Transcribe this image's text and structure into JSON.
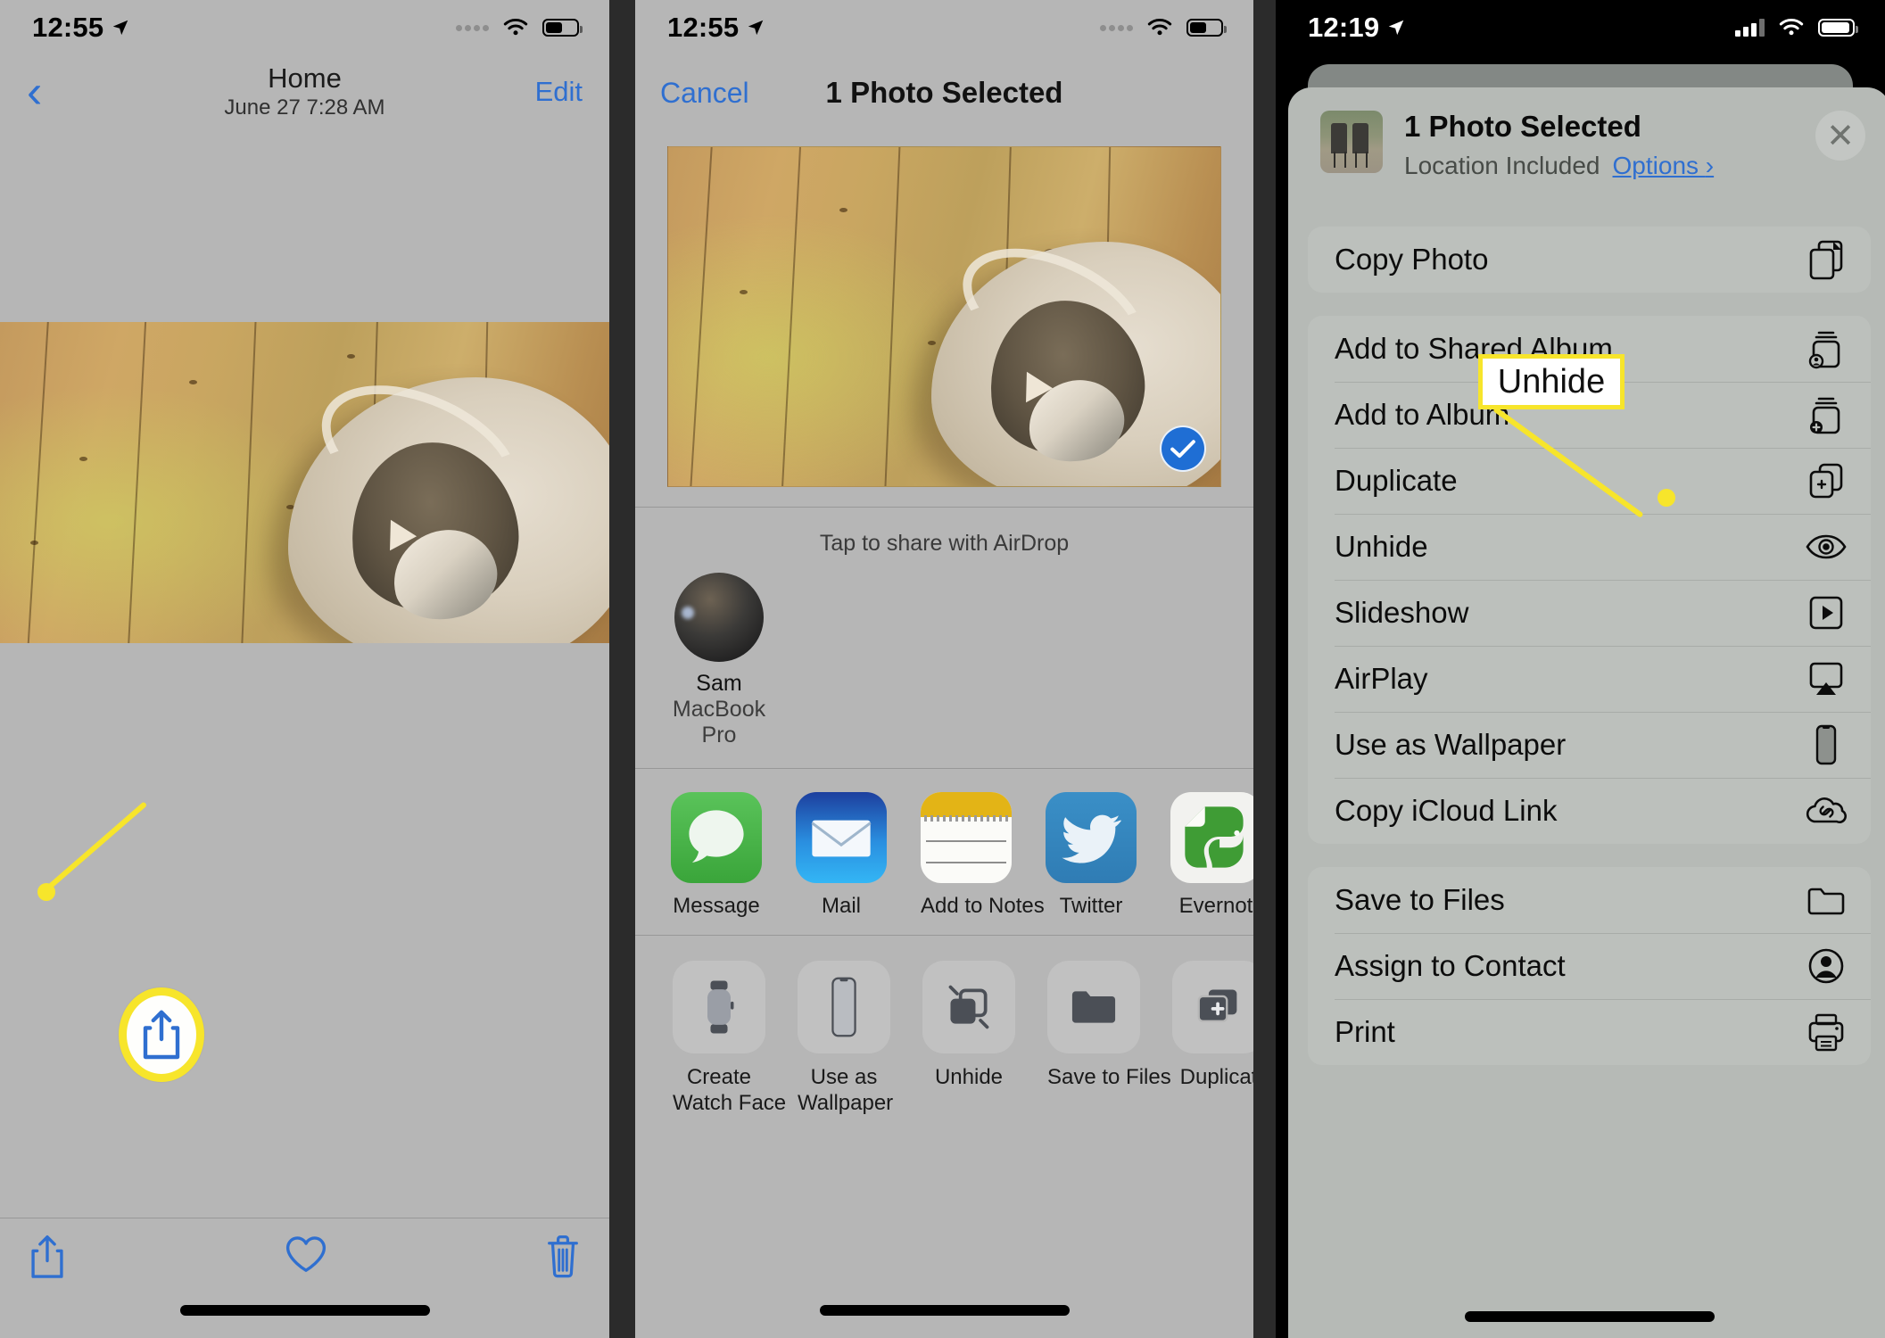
{
  "panels": {
    "left": {
      "status": {
        "time": "12:55",
        "location_icon": "location-arrow-icon",
        "signal": "dots",
        "wifi": "wifi-icon",
        "battery": "battery-icon"
      },
      "navbar": {
        "back_icon": "chevron-left-icon",
        "title": "Home",
        "subtitle": "June 27  7:28 AM",
        "edit_label": "Edit"
      },
      "photo_alt": "cat sleeping in a felt pet cave on a wooden floor",
      "toolbar": {
        "share_icon": "share-icon",
        "favorite_icon": "heart-icon",
        "delete_icon": "trash-icon"
      },
      "callout": {
        "icon": "share-icon",
        "shape": "circle-highlight"
      }
    },
    "middle": {
      "status": {
        "time": "12:55",
        "location_icon": "location-arrow-icon"
      },
      "navbar": {
        "cancel_label": "Cancel",
        "title": "1 Photo Selected"
      },
      "photo_alt": "cat sleeping in a felt pet cave on a wooden floor",
      "selected_badge": "checkmark-icon",
      "airdrop_hint": "Tap to share with AirDrop",
      "airdrop_contact": {
        "name": "Sam",
        "device": "MacBook Pro"
      },
      "apps": [
        {
          "label": "Message",
          "icon": "messages-app-icon"
        },
        {
          "label": "Mail",
          "icon": "mail-app-icon"
        },
        {
          "label": "Add to Notes",
          "icon": "notes-app-icon"
        },
        {
          "label": "Twitter",
          "icon": "twitter-app-icon"
        },
        {
          "label": "Evernot",
          "icon": "evernote-app-icon"
        }
      ],
      "actions": [
        {
          "label": "Create\nWatch Face",
          "icon": "apple-watch-icon"
        },
        {
          "label": "Use as\nWallpaper",
          "icon": "iphone-icon"
        },
        {
          "label": "Unhide",
          "icon": "unhide-icon"
        },
        {
          "label": "Save to Files",
          "icon": "folder-icon"
        },
        {
          "label": "Duplicat",
          "icon": "duplicate-icon"
        }
      ]
    },
    "right": {
      "status": {
        "time": "12:19",
        "location_icon": "location-arrow-icon",
        "signal": "bars",
        "wifi": "wifi-icon",
        "battery": "battery-icon"
      },
      "sheet_header": {
        "title": "1 Photo Selected",
        "subtitle": "Location Included",
        "options_label": "Options",
        "options_chevron": "chevron-right-icon",
        "close_icon": "close-icon",
        "thumbnail_alt": "two folding chairs outdoors"
      },
      "groups": [
        {
          "rows": [
            {
              "label": "Copy Photo",
              "icon": "copy-icon"
            }
          ]
        },
        {
          "rows": [
            {
              "label": "Add to Shared Album",
              "icon": "shared-album-icon"
            },
            {
              "label": "Add to Album",
              "icon": "add-album-icon"
            },
            {
              "label": "Duplicate",
              "icon": "duplicate-icon"
            },
            {
              "label": "Unhide",
              "icon": "eye-icon"
            },
            {
              "label": "Slideshow",
              "icon": "play-icon"
            },
            {
              "label": "AirPlay",
              "icon": "airplay-icon"
            },
            {
              "label": "Use as Wallpaper",
              "icon": "iphone-icon"
            },
            {
              "label": "Copy iCloud Link",
              "icon": "icloud-link-icon"
            }
          ]
        },
        {
          "rows": [
            {
              "label": "Save to Files",
              "icon": "folder-icon"
            },
            {
              "label": "Assign to Contact",
              "icon": "contact-icon"
            },
            {
              "label": "Print",
              "icon": "printer-icon"
            }
          ]
        }
      ]
    }
  },
  "annotations": {
    "unhide_callout_label": "Unhide"
  },
  "colors": {
    "highlight": "#f7e52b",
    "ios_blue": "#2f6fd0",
    "panel_bg": "#b6b6b6",
    "sheet_bg": "#b6bab6",
    "row_bg": "#bcc0bc",
    "divider": "#2b2b2b"
  }
}
